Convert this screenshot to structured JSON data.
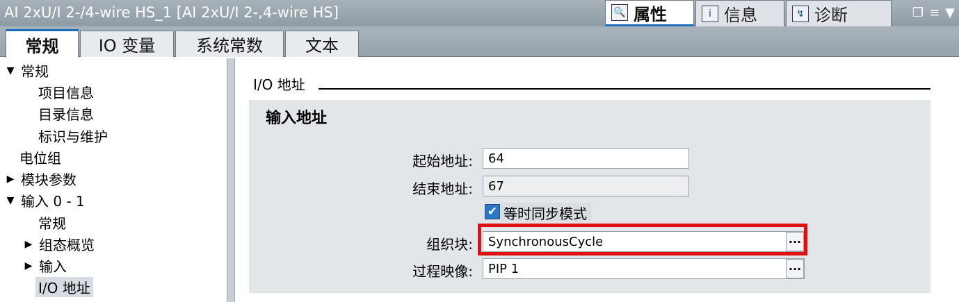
{
  "window": {
    "title": "AI 2xU/I 2-/4-wire HS_1 [AI 2xU/I 2-,4-wire HS]"
  },
  "header_tabs": [
    {
      "label": "属性",
      "icon": "properties-icon",
      "active": true
    },
    {
      "label": "信息",
      "icon": "info-icon",
      "active": false
    },
    {
      "label": "诊断",
      "icon": "diagnostics-icon",
      "active": false
    }
  ],
  "window_controls": {
    "restore": "❐",
    "menu": "≡",
    "chevron": "▼"
  },
  "main_tabs": [
    {
      "label": "常规",
      "active": true
    },
    {
      "label": "IO 变量",
      "active": false
    },
    {
      "label": "系统常数",
      "active": false
    },
    {
      "label": "文本",
      "active": false
    }
  ],
  "nav": {
    "items": [
      {
        "label": "常规",
        "arrow": "▼"
      },
      {
        "label": "项目信息",
        "arrow": ""
      },
      {
        "label": "目录信息",
        "arrow": ""
      },
      {
        "label": "标识与维护",
        "arrow": ""
      },
      {
        "label": "电位组",
        "arrow": ""
      },
      {
        "label": "模块参数",
        "arrow": "▶"
      },
      {
        "label": "输入 0 - 1",
        "arrow": "▼"
      },
      {
        "label": "常规",
        "arrow": ""
      },
      {
        "label": "组态概览",
        "arrow": "▶"
      },
      {
        "label": "输入",
        "arrow": "▶"
      },
      {
        "label": "I/O 地址",
        "arrow": "",
        "selected": true
      }
    ]
  },
  "content": {
    "section_title": "I/O 地址",
    "panel_title": "输入地址",
    "start_address": {
      "label": "起始地址:",
      "value": "64"
    },
    "end_address": {
      "label": "结束地址:",
      "value": "67"
    },
    "isochronous": {
      "label": "等时同步模式",
      "checked": true,
      "check_glyph": "✔"
    },
    "org_block": {
      "label": "组织块:",
      "value": "SynchronousCycle",
      "button": "..."
    },
    "process_image": {
      "label": "过程映像:",
      "value": "PIP 1",
      "button": "..."
    }
  },
  "colors": {
    "accent": "#1c6fb8",
    "highlight": "#e01010"
  }
}
